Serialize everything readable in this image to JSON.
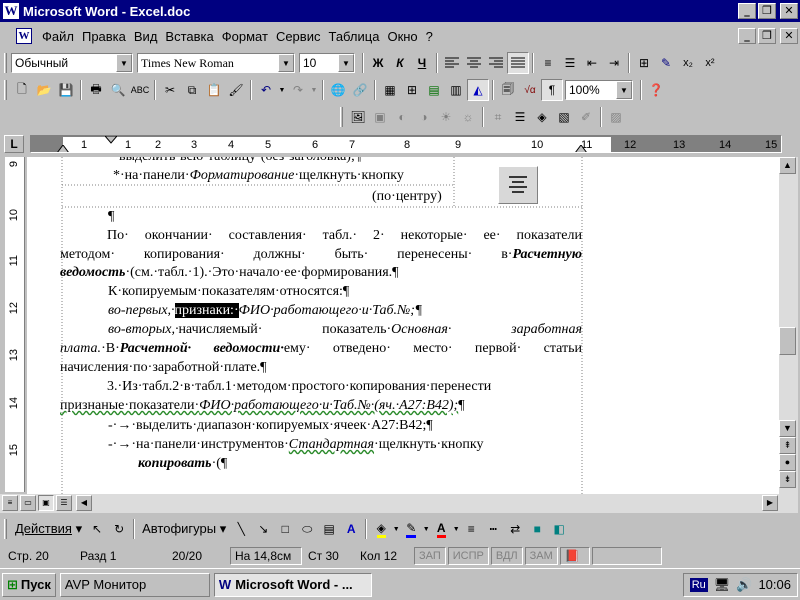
{
  "window": {
    "title": "Microsoft Word - Excel.doc"
  },
  "menu": [
    "Файл",
    "Правка",
    "Вид",
    "Вставка",
    "Формат",
    "Сервис",
    "Таблица",
    "Окно",
    "?"
  ],
  "formatting": {
    "style": "Обычный",
    "font": "Times New Roman",
    "size": "10",
    "bold": "Ж",
    "italic": "К",
    "underline": "Ч"
  },
  "standard": {
    "zoom": "100%"
  },
  "ruler": {
    "corner": "L",
    "ticks": [
      "1",
      "1",
      "2",
      "3",
      "4",
      "5",
      "6",
      "7",
      "8",
      "9",
      "10",
      "11",
      "12",
      "13",
      "14",
      "15"
    ],
    "vticks": [
      "9",
      "10",
      "11",
      "12",
      "13",
      "14",
      "15"
    ]
  },
  "document": {
    "line0": "выделить·всю·таблицу·(без·заголовка);¶",
    "line1_prefix": "*·на·панели·",
    "line1_it": "Форматирование",
    "line1_suffix": "·щелкнуть·кнопку",
    "line2": "(по·центру)",
    "pilcrow": "¶",
    "p1_l1": "По· окончании· составления· табл.· 2· некоторые· ее· показатели",
    "p1_l2_a": "методом· копирования· должны· быть· перенесены· в·",
    "p1_l2_b": "Расчетную",
    "p1_l3_a": "ведомость",
    "p1_l3_b": "·(см.·табл.·1).·Это·начало·ее·формирования.¶",
    "p2": "К·копируемым·показателям·относятся:¶",
    "p3_a": "во-первых,·",
    "p3_sel": "признаки:·",
    "p3_b": "ФИО·работающего·и·Таб.№;¶",
    "p4_l1_a": "во-вторых,·",
    "p4_l1_b": "начисляемый· показатель·",
    "p4_l1_c": "Основная· заработная",
    "p4_l2_a": "плата.",
    "p4_l2_b": "·В·",
    "p4_l2_c": "Расчетной· ведомости·",
    "p4_l2_d": "ему· отведено· место· первой· статьи",
    "p4_l3": "начисления·по·заработной·плате.¶",
    "p5_l1": "3.·Из·табл.2·в·табл.1·методом·простого·копирования·перенести",
    "p5_l2_a": "признаные·показатели·",
    "p5_l2_b": "ФИО·работающего·и·Таб.№·(яч.·А27:В42);",
    "p5_l2_c": "¶",
    "b1": "-·→·выделить·диапазон·копируемых·ячеек·А27:В42;¶",
    "b2_a": "-·→·на·панели·инструментов·",
    "b2_b": "Стандартная",
    "b2_c": "·щелкнуть·кнопку",
    "b2_l2_a": "копировать",
    "b2_l2_b": "·(¶"
  },
  "drawing": {
    "actions": "Действия",
    "autoshapes": "Автофигуры"
  },
  "status": {
    "page": "Стр. 20",
    "section": "Разд 1",
    "pages": "20/20",
    "at": "На 14,8см",
    "line": "Ст 30",
    "col": "Кол 12",
    "rec": "ЗАП",
    "trk": "ИСПР",
    "ext": "ВДЛ",
    "ovr": "ЗАМ"
  },
  "taskbar": {
    "start": "Пуск",
    "task1": "AVP Монитор",
    "task2": "Microsoft Word - ...",
    "lang": "Ru",
    "time": "10:06"
  },
  "colors": {
    "titlebar": "#000080",
    "chrome": "#c0c0c0",
    "selection": "#000000"
  }
}
